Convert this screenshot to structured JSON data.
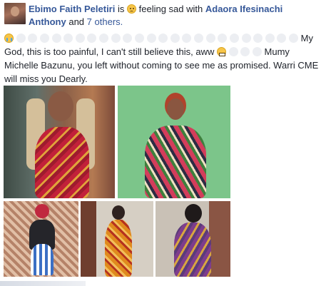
{
  "post": {
    "author_name": "Ebimo Faith Peletiri",
    "is_text": "is",
    "feeling_text": "feeling sad with",
    "tagged_name": "Adaora Ifesinachi Anthony",
    "and_text": "and",
    "others_text": "7 others.",
    "body_part1": "My God, this is too painful, I can't still believe this, aww",
    "body_part2": "Mumy Michelle Bazunu, you left without coming to see me as promised. Warri CME will miss you Dearly."
  },
  "icons": {
    "avatar": "profile-photo",
    "feeling": "sad-face-emoji",
    "crying": "crying-face-emoji",
    "grimace": "grimacing-face-emoji"
  },
  "colors": {
    "link": "#365899",
    "text": "#1d2129"
  }
}
